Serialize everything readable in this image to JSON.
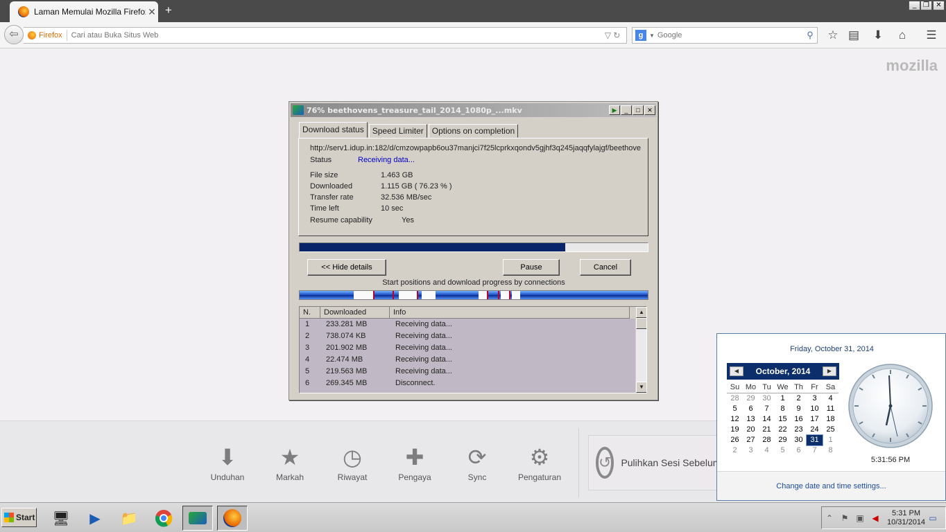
{
  "browser": {
    "tab_title": "Laman Memulai Mozilla Firefox",
    "identity_label": "Firefox",
    "url_placeholder": "Cari atau Buka Situs Web",
    "search_placeholder": "Google",
    "brand": "mozilla"
  },
  "launcher": {
    "items": [
      {
        "label": "Unduhan",
        "icon": "download-icon"
      },
      {
        "label": "Markah",
        "icon": "star-icon"
      },
      {
        "label": "Riwayat",
        "icon": "clock-icon"
      },
      {
        "label": "Pengaya",
        "icon": "puzzle-icon"
      },
      {
        "label": "Sync",
        "icon": "sync-icon"
      },
      {
        "label": "Pengaturan",
        "icon": "gear-icon"
      }
    ],
    "restore_label": "Pulihkan Sesi Sebelumnya"
  },
  "idm": {
    "title": "76% beethovens_treasure_tail_2014_1080p_...mkv",
    "tabs": [
      "Download status",
      "Speed Limiter",
      "Options on completion"
    ],
    "url": "http://serv1.idup.in:182/d/cmzowpapb6ou37manjci7f25lcprkxqondv5gjhf3q245jaqqfylajgf/beethove",
    "status_label": "Status",
    "status_value": "Receiving data...",
    "fields": [
      {
        "label": "File size",
        "value": "1.463  GB"
      },
      {
        "label": "Downloaded",
        "value": "1.115  GB  ( 76.23 % )"
      },
      {
        "label": "Transfer rate",
        "value": "32.536  MB/sec"
      },
      {
        "label": "Time left",
        "value": "10 sec"
      }
    ],
    "resume_label": "Resume capability",
    "resume_value": "Yes",
    "progress": 0.7623,
    "hide_details_label": "<< Hide details",
    "pause_label": "Pause",
    "cancel_label": "Cancel",
    "connections_caption": "Start positions and download progress by connections",
    "columns": [
      "N.",
      "Downloaded",
      "Info"
    ],
    "connections": [
      {
        "n": "1",
        "downloaded": "233.281  MB",
        "info": "Receiving data..."
      },
      {
        "n": "2",
        "downloaded": "738.074  KB",
        "info": "Receiving data..."
      },
      {
        "n": "3",
        "downloaded": "201.902  MB",
        "info": "Receiving data..."
      },
      {
        "n": "4",
        "downloaded": "22.474  MB",
        "info": "Receiving data..."
      },
      {
        "n": "5",
        "downloaded": "219.563  MB",
        "info": "Receiving data..."
      },
      {
        "n": "6",
        "downloaded": "269.345  MB",
        "info": "Disconnect."
      }
    ]
  },
  "calendar": {
    "long_date": "Friday, October 31, 2014",
    "month_label": "October, 2014",
    "weekdays": [
      "Su",
      "Mo",
      "Tu",
      "We",
      "Th",
      "Fr",
      "Sa"
    ],
    "days": [
      [
        "28",
        "29",
        "30",
        "1",
        "2",
        "3",
        "4"
      ],
      [
        "5",
        "6",
        "7",
        "8",
        "9",
        "10",
        "11"
      ],
      [
        "12",
        "13",
        "14",
        "15",
        "16",
        "17",
        "18"
      ],
      [
        "19",
        "20",
        "21",
        "22",
        "23",
        "24",
        "25"
      ],
      [
        "26",
        "27",
        "28",
        "29",
        "30",
        "31",
        "1"
      ],
      [
        "2",
        "3",
        "4",
        "5",
        "6",
        "7",
        "8"
      ]
    ],
    "selected_day": "31",
    "clock_time": "5:31:56 PM",
    "settings_link": "Change date and time settings..."
  },
  "taskbar": {
    "start_label": "Start",
    "apps": [
      "server-manager-icon",
      "powershell-icon",
      "explorer-icon",
      "chrome-icon",
      "idm-icon",
      "firefox-icon"
    ],
    "tray_time": "5:31 PM",
    "tray_date": "10/31/2014"
  },
  "colors": {
    "progress_fill": "#0a246a",
    "calendar_header": "#0c2f6b",
    "status_text": "#0000c8"
  }
}
